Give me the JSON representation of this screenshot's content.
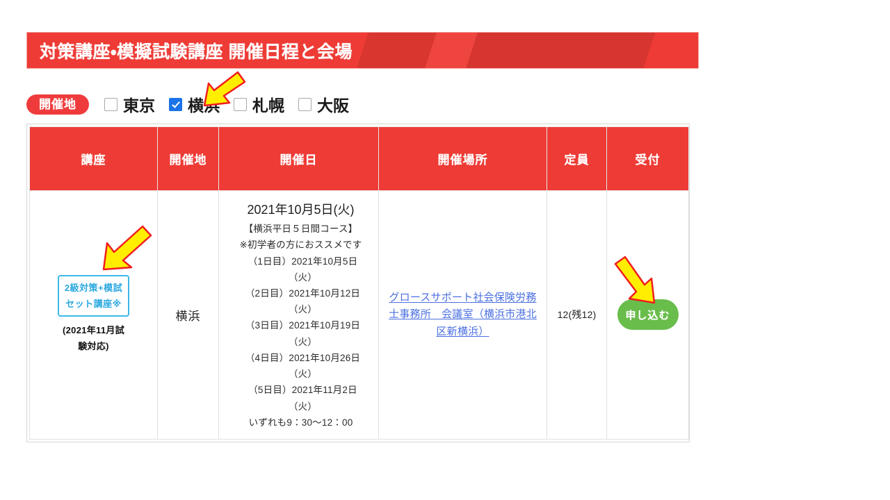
{
  "banner": {
    "title": "対策講座・模擬試験講座 開催日程と会場",
    "bg_color": "#ee3b35"
  },
  "filter": {
    "pill_label": "開催地",
    "options": [
      {
        "label": "東京",
        "checked": false
      },
      {
        "label": "横浜",
        "checked": true
      },
      {
        "label": "札幌",
        "checked": false
      },
      {
        "label": "大阪",
        "checked": false
      }
    ]
  },
  "table": {
    "headers": [
      "講座",
      "開催地",
      "開催日",
      "開催場所",
      "定員",
      "受付"
    ],
    "rows": [
      {
        "course_box": [
          "2級対策+模試",
          "セット講座※"
        ],
        "course_note": [
          "(2021年11月試",
          "験対応)"
        ],
        "city": "横浜",
        "date_main": "2021年10月5日(火)",
        "date_lines": [
          "【横浜平日５日間コース】",
          "※初学者の方におススメです",
          "（1日目）2021年10月5日",
          "（火）",
          "（2日目）2021年10月12日",
          "（火）",
          "（3日目）2021年10月19日",
          "（火）",
          "（4日目）2021年10月26日",
          "（火）",
          "（5日目）2021年11月2日",
          "（火）",
          "いずれも9：30〜12：00"
        ],
        "venue_link": "グロースサポート社会保険労務士事務所　会議室（横浜市港北区新横浜）",
        "capacity": "12(残12)",
        "apply_label": "申し込む"
      }
    ]
  },
  "annotations": {
    "arrow_color": "#ffee00",
    "arrow_outline": "#f01d1d",
    "arrows": [
      {
        "name": "arrow-to-yokohama-checkbox",
        "target": "横浜 checkbox"
      },
      {
        "name": "arrow-to-course-box",
        "target": "2級対策+模試セット講座※"
      },
      {
        "name": "arrow-to-apply-button",
        "target": "申し込む"
      }
    ]
  }
}
